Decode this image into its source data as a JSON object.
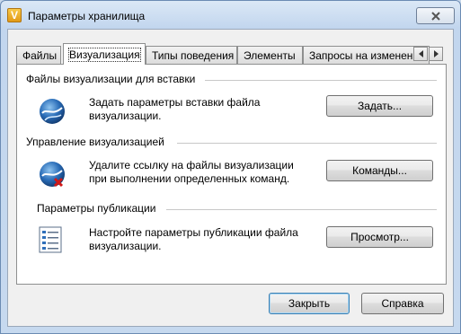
{
  "window": {
    "title": "Параметры хранилища",
    "app_icon": "V"
  },
  "tabs": [
    {
      "label": "Файлы"
    },
    {
      "label": "Визуализация"
    },
    {
      "label": "Типы поведения"
    },
    {
      "label": "Элементы"
    },
    {
      "label": "Запросы на изменение"
    }
  ],
  "sections": {
    "attach": {
      "title": "Файлы визуализации для вставки",
      "description": "Задать параметры вставки файла визуализации.",
      "button": "Задать...",
      "icon": "globe-attach-icon"
    },
    "manage": {
      "title": "Управление визуализацией",
      "description": "Удалите ссылку на файлы визуализации при выполнении определенных команд.",
      "button": "Команды...",
      "icon": "globe-remove-icon"
    },
    "publish": {
      "title": "Параметры публикации",
      "description": "Настройте параметры публикации файла визуализации.",
      "button": "Просмотр...",
      "icon": "publish-list-icon"
    }
  },
  "footer": {
    "close": "Закрыть",
    "help": "Справка"
  }
}
